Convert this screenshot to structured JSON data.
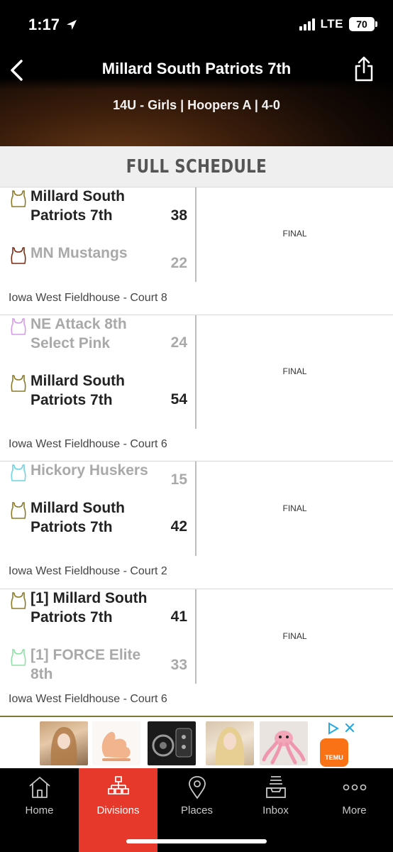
{
  "status_bar": {
    "time": "1:17",
    "network": "LTE",
    "battery": "70"
  },
  "header": {
    "title": "Millard South Patriots 7th",
    "subtitle": "14U - Girls | Hoopers A | 4-0"
  },
  "section": {
    "title": "FULL SCHEDULE"
  },
  "games": [
    {
      "team1": {
        "name": "Millard South Patriots 7th",
        "score": "38",
        "jersey_color": "#8a7a2a"
      },
      "team2": {
        "name": "MN Mustangs",
        "score": "22",
        "jersey_color": "#7a2d14"
      },
      "status": "FINAL",
      "venue": "Iowa West Fieldhouse - Court 8"
    },
    {
      "team1": {
        "name": "NE Attack 8th Select Pink",
        "score": "24",
        "jersey_color": "#d59be8"
      },
      "team2": {
        "name": "Millard South Patriots 7th",
        "score": "54",
        "jersey_color": "#8a7a2a"
      },
      "status": "FINAL",
      "venue": "Iowa West Fieldhouse - Court 6"
    },
    {
      "team1": {
        "name": "Hickory Huskers",
        "score": "15",
        "jersey_color": "#6fd3e0"
      },
      "team2": {
        "name": "Millard South Patriots 7th",
        "score": "42",
        "jersey_color": "#8a7a2a"
      },
      "status": "FINAL",
      "venue": "Iowa West Fieldhouse - Court 2"
    },
    {
      "team1": {
        "name": "[1] Millard South Patriots 7th",
        "score": "41",
        "jersey_color": "#8a7a2a"
      },
      "team2": {
        "name": "[1] FORCE Elite 8th",
        "score": "33",
        "jersey_color": "#8fe0a6"
      },
      "status": "FINAL",
      "venue": "Iowa West Fieldhouse - Court 6"
    }
  ],
  "ad": {
    "brand": "TEMU"
  },
  "tabs": [
    {
      "label": "Home",
      "icon": "home-icon"
    },
    {
      "label": "Divisions",
      "icon": "bracket-icon",
      "active": true
    },
    {
      "label": "Places",
      "icon": "location-pin-icon"
    },
    {
      "label": "Inbox",
      "icon": "inbox-icon"
    },
    {
      "label": "More",
      "icon": "more-dots-icon"
    }
  ],
  "colors": {
    "accent": "#e7392b",
    "winner_text": "#222222",
    "loser_text": "#a9a9a9"
  }
}
